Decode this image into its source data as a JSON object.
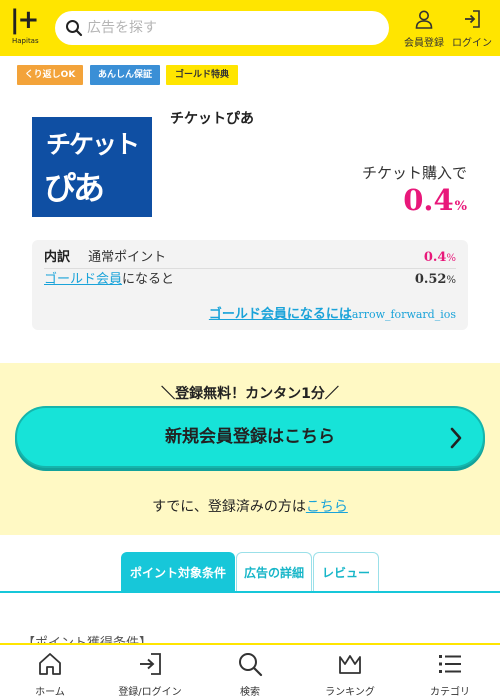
{
  "header": {
    "logo_mark": "|+",
    "logo_text": "Hapitas",
    "search_placeholder": "広告を探す",
    "register_label": "会員登録",
    "login_label": "ログイン"
  },
  "tags": [
    "くり返しOK",
    "あんしん保証",
    "ゴールド特典"
  ],
  "shop": {
    "logo_line1": "チケット",
    "logo_line2": "ぴあ",
    "name": "チケットぴあ",
    "condition": "チケット購入で",
    "rate": "0.4",
    "rate_unit": "%"
  },
  "breakdown": {
    "label": "内訳",
    "normal_label": "通常ポイント",
    "normal_value": "0.4",
    "gold_link": "ゴールド会員",
    "gold_suffix": "になると",
    "gold_value": "0.52",
    "unit": "%",
    "gold_more": "ゴールド会員になるには",
    "gold_more_icon": "arrow_forward_ios"
  },
  "register": {
    "catch": "＼登録無料！カンタン1分／",
    "button": "新規会員登録はこちら",
    "already_prefix": "すでに、登録済みの方は",
    "already_link": "こちら"
  },
  "tabs": [
    "ポイント対象条件",
    "広告の詳細",
    "レビュー"
  ],
  "section_title": "【ポイント獲得条件】",
  "bottom_nav": [
    "ホーム",
    "登録/ログイン",
    "検索",
    "ランキング",
    "カテゴリ"
  ],
  "colors": {
    "brand_yellow": "#ffe500",
    "accent_pink": "#e8187a",
    "link_blue": "#1aa3d9",
    "cta_teal": "#17e3d8",
    "tab_teal": "#17c7d9"
  }
}
